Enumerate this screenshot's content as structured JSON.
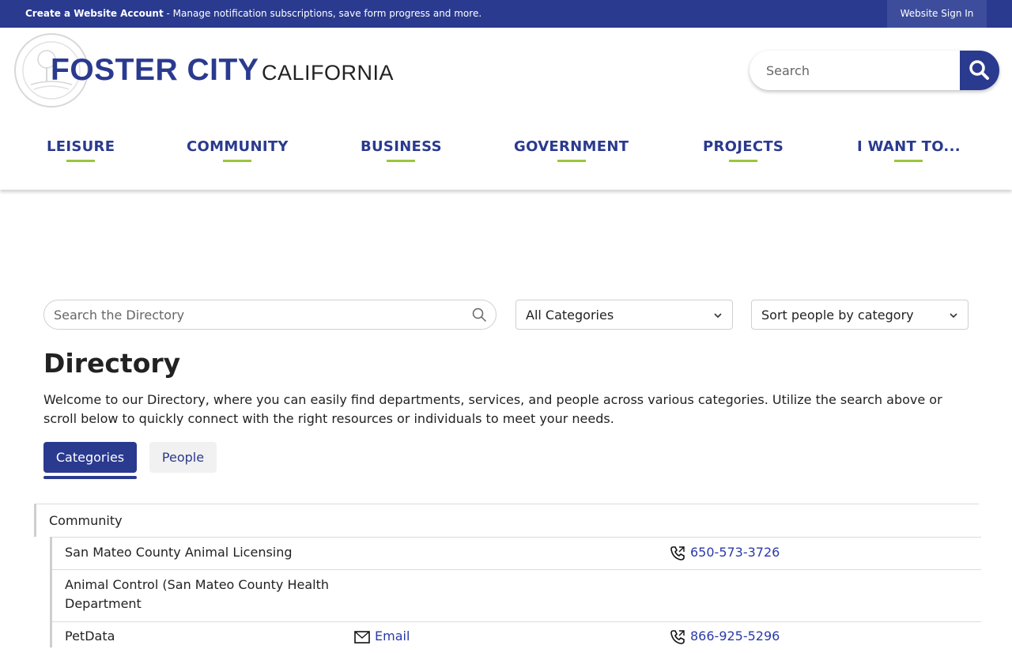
{
  "topbar": {
    "create_account_label": "Create a Website Account",
    "create_account_desc": " - Manage notification subscriptions, save form progress and more.",
    "sign_in_label": "Website Sign In"
  },
  "header": {
    "logo_main": "FOSTER CITY",
    "logo_sub": "CALIFORNIA",
    "search_placeholder": "Search"
  },
  "nav": {
    "items": [
      {
        "label": "LEISURE"
      },
      {
        "label": "COMMUNITY"
      },
      {
        "label": "BUSINESS"
      },
      {
        "label": "GOVERNMENT"
      },
      {
        "label": "PROJECTS"
      },
      {
        "label": "I WANT TO..."
      }
    ]
  },
  "directory": {
    "search_placeholder": "Search the Directory",
    "category_select": "All Categories",
    "sort_select": "Sort people by category",
    "title": "Directory",
    "intro": "Welcome to our Directory, where you can easily find departments, services, and people across various categories. Utilize the search above or scroll below to quickly connect with the right resources or individuals to meet your needs.",
    "tabs": [
      {
        "label": "Categories",
        "active": true
      },
      {
        "label": "People",
        "active": false
      }
    ],
    "category": "Community",
    "entries": [
      {
        "name": "San Mateo County Animal Licensing",
        "phone": "650-573-3726"
      },
      {
        "name": "Animal Control (San Mateo County Health Department"
      },
      {
        "name": "PetData",
        "email": "Email",
        "phone": "866-925-5296"
      }
    ]
  },
  "colors": {
    "brand": "#2a3a8f",
    "accent": "#9bc53d",
    "link": "#2a3aa8"
  }
}
